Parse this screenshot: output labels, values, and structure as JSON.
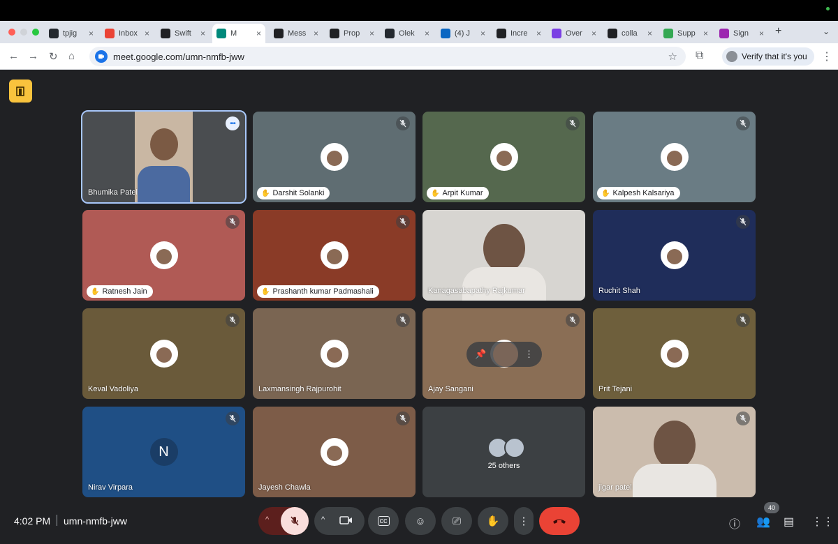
{
  "browser": {
    "tabs": [
      {
        "label": "tpjig",
        "favicon": "github-icon",
        "color": "#24292f"
      },
      {
        "label": "Inbox",
        "favicon": "gmail-icon",
        "color": "#ea4335"
      },
      {
        "label": "Swift",
        "favicon": "sparkle-icon",
        "color": "#202124"
      },
      {
        "label": "M",
        "favicon": "meet-icon",
        "color": "#00897b",
        "active": true
      },
      {
        "label": "Mess",
        "favicon": "upwork-icon",
        "color": "#202124"
      },
      {
        "label": "Prop",
        "favicon": "upwork-icon",
        "color": "#202124"
      },
      {
        "label": "Olek",
        "favicon": "github-icon",
        "color": "#24292f"
      },
      {
        "label": "(4) J",
        "favicon": "linkedin-icon",
        "color": "#0a66c2"
      },
      {
        "label": "Incre",
        "favicon": "openai-icon",
        "color": "#202124"
      },
      {
        "label": "Over",
        "favicon": "m-icon",
        "color": "#7b3fe4"
      },
      {
        "label": "colla",
        "favicon": "co-icon",
        "color": "#202124"
      },
      {
        "label": "Supp",
        "favicon": "check-icon",
        "color": "#34a853"
      },
      {
        "label": "Sign",
        "favicon": "m-icon",
        "color": "#9c27b0"
      }
    ],
    "url": "meet.google.com/umn-nmfb-jww",
    "verify_label": "Verify that it's you"
  },
  "participants": [
    {
      "name": "Bhumika Patel",
      "style": "video",
      "bg": "#4a4d50"
    },
    {
      "name": "Darshit Solanki",
      "style": "pill",
      "bg": "#5f6d72"
    },
    {
      "name": "Arpit Kumar",
      "style": "pill",
      "bg": "#55684e"
    },
    {
      "name": "Kalpesh Kalsariya",
      "style": "pill",
      "bg": "#6a7c84"
    },
    {
      "name": "Ratnesh Jain",
      "style": "pill",
      "bg": "#b05a55"
    },
    {
      "name": "Prashanth kumar Padmashali",
      "style": "pill",
      "bg": "#8a3b27"
    },
    {
      "name": "Kanagasabapathy Rajkumar",
      "style": "video",
      "bg": "#d7d5d1"
    },
    {
      "name": "Ruchit Shah",
      "style": "plain",
      "bg": "#1f2d5a"
    },
    {
      "name": "Keval Vadoliya",
      "style": "plain",
      "bg": "#6a5a3a"
    },
    {
      "name": "Laxmansingh Rajpurohit",
      "style": "plain",
      "bg": "#7a6552"
    },
    {
      "name": "Ajay Sangani",
      "style": "plain",
      "bg": "#8a6e55"
    },
    {
      "name": "Prit Tejani",
      "style": "plain",
      "bg": "#6e5f3c"
    },
    {
      "name": "Nirav Virpara",
      "style": "plain",
      "bg": "#1f4f85",
      "initial": "N"
    },
    {
      "name": "Jayesh Chawla",
      "style": "plain",
      "bg": "#7d5c48"
    },
    {
      "name": "jigar patel",
      "style": "video",
      "bg": "#cbbcad"
    }
  ],
  "others_label": "25 others",
  "meeting": {
    "time": "4:02 PM",
    "code": "umn-nmfb-jww"
  },
  "people_count": "40",
  "colors": {
    "end_call": "#ea4335",
    "mic_muted": "#f9dedc",
    "calendar": "#f9c33d"
  }
}
